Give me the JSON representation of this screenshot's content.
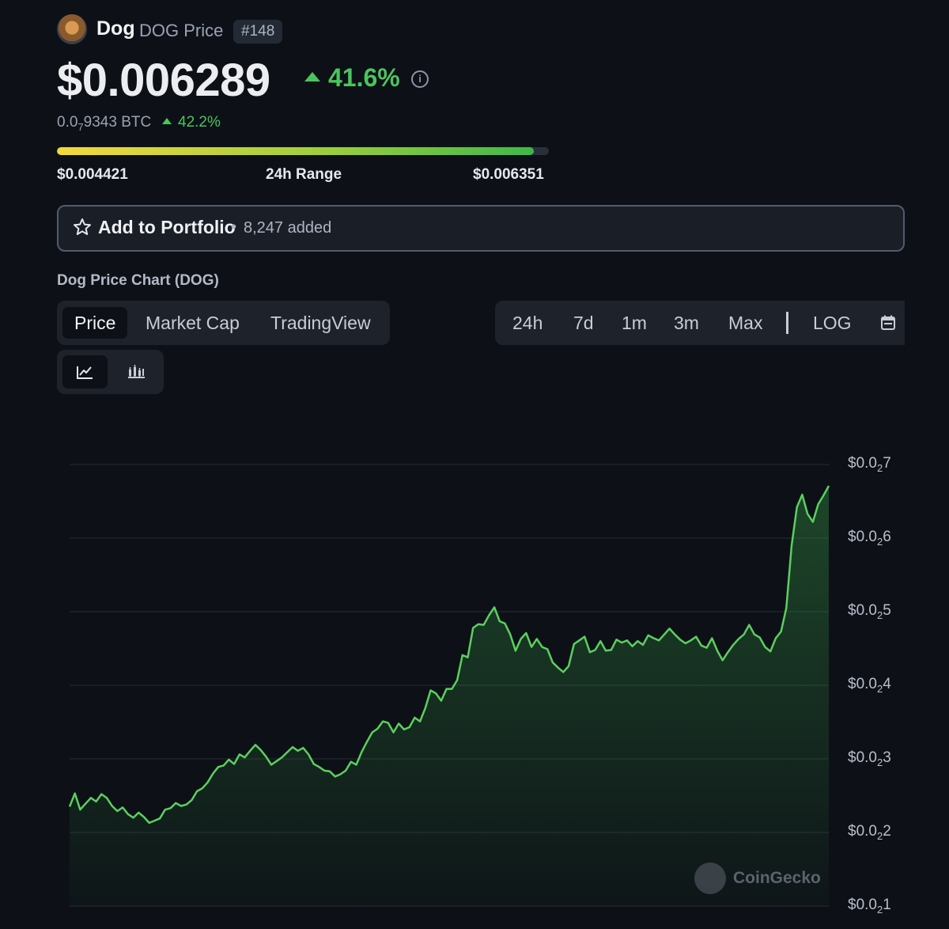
{
  "header": {
    "coin_name": "Dog",
    "coin_subtitle": "DOG Price",
    "rank": "#148",
    "price": "$0.006289",
    "price_change": "41.6%",
    "btc_price_prefix": "0.0",
    "btc_price_sub": "7",
    "btc_price_rest": "9343 BTC",
    "btc_change": "42.2%",
    "info_icon": "info-icon"
  },
  "range_24h": {
    "low": "$0.004421",
    "label": "24h Range",
    "high": "$0.006351",
    "position_fraction": 0.97
  },
  "portfolio": {
    "label": "Add to Portfolio",
    "separator": "•",
    "count": "8,247 added",
    "icon": "star-icon"
  },
  "chart_title": "Dog Price Chart (DOG)",
  "tabs": [
    {
      "label": "Price",
      "active": true
    },
    {
      "label": "Market Cap",
      "active": false
    },
    {
      "label": "TradingView",
      "active": false
    }
  ],
  "time_ranges": [
    "24h",
    "7d",
    "1m",
    "3m",
    "Max"
  ],
  "log_label": "LOG",
  "calendar_icon": "calendar-icon",
  "chart_type_icons": [
    "line-chart-icon",
    "candlestick-chart-icon"
  ],
  "watermark": "CoinGecko",
  "colors": {
    "background": "#0d1117",
    "positive": "#4cc45d",
    "line": "#5ccf5f"
  },
  "chart_data": {
    "type": "area",
    "y_ticks": [
      {
        "prefix": "$0.0",
        "sub": "2",
        "rest": "7"
      },
      {
        "prefix": "$0.0",
        "sub": "2",
        "rest": "6"
      },
      {
        "prefix": "$0.0",
        "sub": "2",
        "rest": "5"
      },
      {
        "prefix": "$0.0",
        "sub": "2",
        "rest": "4"
      },
      {
        "prefix": "$0.0",
        "sub": "2",
        "rest": "3"
      },
      {
        "prefix": "$0.0",
        "sub": "2",
        "rest": "2"
      },
      {
        "prefix": "$0.0",
        "sub": "2",
        "rest": "1"
      }
    ],
    "ylim": [
      0.001,
      0.007
    ],
    "grid": true,
    "values": [
      0.00235,
      0.00253,
      0.00231,
      0.00239,
      0.00247,
      0.00242,
      0.00252,
      0.00247,
      0.00236,
      0.00229,
      0.00234,
      0.00225,
      0.0022,
      0.00227,
      0.00221,
      0.00213,
      0.00216,
      0.00219,
      0.00231,
      0.00233,
      0.0024,
      0.00236,
      0.00238,
      0.00244,
      0.00256,
      0.0026,
      0.00268,
      0.0028,
      0.00289,
      0.00291,
      0.00299,
      0.00293,
      0.00306,
      0.00302,
      0.00311,
      0.00319,
      0.00312,
      0.00303,
      0.00292,
      0.00297,
      0.00302,
      0.00309,
      0.00316,
      0.00311,
      0.00315,
      0.00306,
      0.00293,
      0.00289,
      0.00284,
      0.00283,
      0.00276,
      0.00279,
      0.00284,
      0.00296,
      0.00292,
      0.00309,
      0.00323,
      0.00336,
      0.00341,
      0.00351,
      0.00349,
      0.00336,
      0.00348,
      0.0034,
      0.00343,
      0.00356,
      0.00351,
      0.00369,
      0.00393,
      0.00389,
      0.00379,
      0.00395,
      0.00395,
      0.00407,
      0.00441,
      0.00438,
      0.00478,
      0.00483,
      0.00482,
      0.00495,
      0.00506,
      0.00487,
      0.00484,
      0.00469,
      0.00447,
      0.00463,
      0.00471,
      0.00452,
      0.00463,
      0.00452,
      0.00449,
      0.00431,
      0.00424,
      0.00418,
      0.00426,
      0.00456,
      0.00461,
      0.00466,
      0.00445,
      0.00448,
      0.0046,
      0.00447,
      0.00448,
      0.00462,
      0.00458,
      0.00461,
      0.00453,
      0.0046,
      0.00455,
      0.00468,
      0.00464,
      0.00461,
      0.00469,
      0.00477,
      0.00469,
      0.00462,
      0.00457,
      0.00461,
      0.00466,
      0.00454,
      0.00451,
      0.00464,
      0.00447,
      0.00434,
      0.00445,
      0.00455,
      0.00463,
      0.00469,
      0.00482,
      0.00469,
      0.00465,
      0.00452,
      0.00446,
      0.00464,
      0.00473,
      0.00505,
      0.0059,
      0.00642,
      0.00659,
      0.00633,
      0.00622,
      0.00646,
      0.00658,
      0.00671
    ]
  }
}
